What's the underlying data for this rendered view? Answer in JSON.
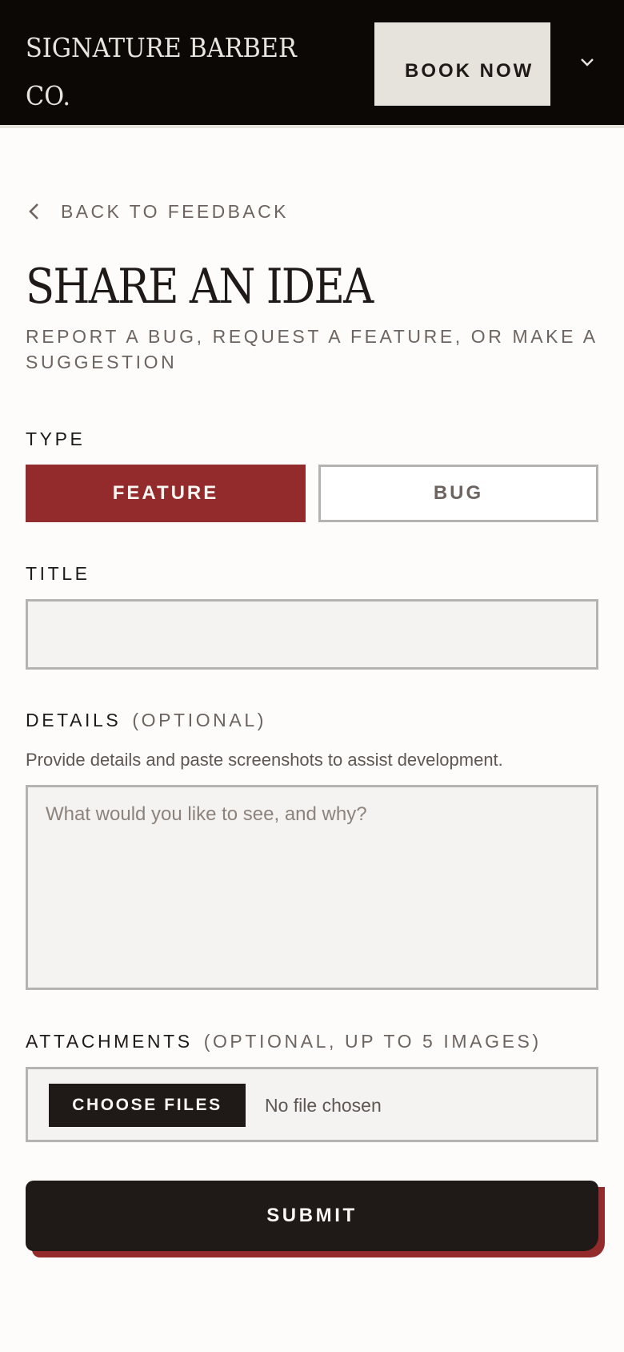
{
  "header": {
    "brand": "SIGNATURE BARBER CO.",
    "book_label": "BOOK NOW",
    "menu_icon": "chevron-down-icon"
  },
  "back": {
    "label": "BACK TO FEEDBACK",
    "icon": "chevron-left-icon"
  },
  "page": {
    "title": "SHARE AN IDEA",
    "subtitle": "REPORT A BUG, REQUEST A FEATURE, OR MAKE A SUGGESTION"
  },
  "form": {
    "type_label": "TYPE",
    "type_options": [
      {
        "label": "FEATURE",
        "selected": true
      },
      {
        "label": "BUG",
        "selected": false
      }
    ],
    "title_label": "TITLE",
    "title_value": "",
    "details_label": "DETAILS",
    "details_optional": "(OPTIONAL)",
    "details_helper": "Provide details and paste screenshots to assist development.",
    "details_placeholder": "What would you like to see, and why?",
    "attachments_label": "ATTACHMENTS",
    "attachments_optional": "(OPTIONAL, UP TO 5 IMAGES)",
    "choose_files_label": "CHOOSE FILES",
    "no_file_text": "No file chosen",
    "submit_label": "SUBMIT"
  },
  "colors": {
    "header_bg": "#0c0806",
    "accent_red": "#932a2c",
    "dark": "#1f1a18",
    "page_bg": "#fdfcfa"
  }
}
